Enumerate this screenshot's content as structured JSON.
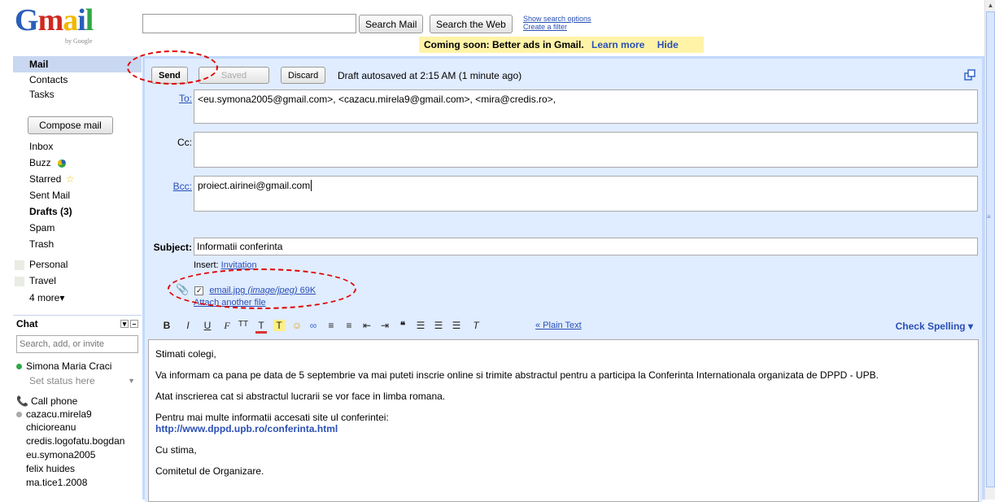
{
  "header": {
    "logo_letters": [
      "G",
      "m",
      "a",
      "i",
      "l"
    ],
    "logo_colors": [
      "#2a5fb8",
      "#d0281f",
      "#f1b800",
      "#2a5fb8",
      "#2fa745"
    ],
    "logo_byline": "by Google",
    "search_value": "",
    "search_mail_label": "Search Mail",
    "search_web_label": "Search the Web",
    "show_search_options": "Show search options",
    "create_filter": "Create a filter",
    "promo_text": "Coming soon: Better ads in Gmail.",
    "promo_learn_more": "Learn more",
    "promo_hide": "Hide"
  },
  "sidebar": {
    "top_items": [
      "Mail",
      "Contacts",
      "Tasks"
    ],
    "compose_label": "Compose mail",
    "folders": [
      {
        "label": "Inbox"
      },
      {
        "label": "Buzz",
        "icon": "buzz-icon"
      },
      {
        "label": "Starred",
        "icon": "star-icon"
      },
      {
        "label": "Sent Mail"
      },
      {
        "label": "Drafts (3)"
      },
      {
        "label": "Spam"
      },
      {
        "label": "Trash"
      }
    ],
    "labels": [
      "Personal",
      "Travel"
    ],
    "more_labels": "4 more▾"
  },
  "chat": {
    "title": "Chat",
    "search_placeholder": "Search, add, or invite",
    "self_name": "Simona Maria Craci",
    "status_text": "Set status here",
    "call_phone": "Call phone",
    "contacts": [
      "cazacu.mirela9",
      "chicioreanu",
      "credis.logofatu.bogdan",
      "eu.symona2005",
      "felix huides",
      "ma.tice1.2008"
    ],
    "online_color": "#2fa745",
    "idle_color": "#aaaaaa"
  },
  "compose": {
    "send_label": "Send",
    "saved_label": "Saved",
    "discard_label": "Discard",
    "draft_status": "Draft autosaved at 2:15 AM (1 minute ago)",
    "to_label": "To:",
    "to_value": "<eu.symona2005@gmail.com>, <cazacu.mirela9@gmail.com>, <mira@credis.ro>,",
    "cc_label": "Cc:",
    "cc_value": "",
    "bcc_label": "Bcc:",
    "bcc_value": "proiect.airinei@gmail.com",
    "subject_label": "Subject:",
    "subject_value": "Informatii conferinta",
    "insert_label": "Insert:",
    "insert_link": "Invitation",
    "attachment": "email.jpg",
    "attachment_type": "(image/jpeg)",
    "attachment_size": "69K",
    "attach_another": "Attach another file",
    "plain_text": "« Plain Text",
    "check_spelling": "Check Spelling ▾",
    "body": [
      "Stimati colegi,",
      "Va informam ca pana pe data de 5 septembrie va mai puteti inscrie online si trimite abstractul pentru a participa la Conferinta Internationala organizata de DPPD  - UPB.",
      "Atat inscrierea cat si abstractul lucrarii se vor face in limba romana.",
      "Pentru mai multe informatii accesati site ul conferintei:",
      "Cu stima,",
      "Comitetul de Organizare."
    ],
    "body_link": "http://www.dppd.upb.ro/conferinta.html"
  },
  "colors": {
    "annotation": "#e00000",
    "link": "#2a4fb5",
    "compose_bg": "#e0ecff",
    "selected_nav": "#c9d7f1",
    "promo_bg": "#fff3a8"
  }
}
